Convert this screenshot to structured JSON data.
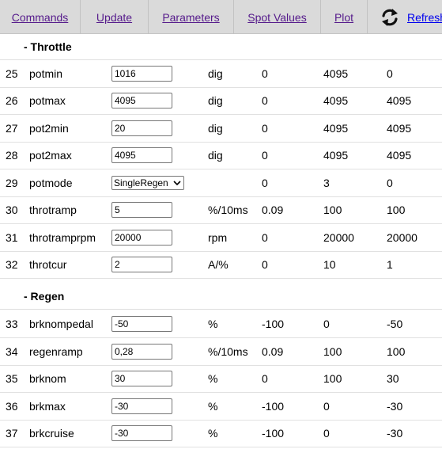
{
  "nav": {
    "items": [
      "Commands",
      "Update",
      "Parameters",
      "Spot Values",
      "Plot"
    ],
    "refresh_label": "Refresh"
  },
  "sections": [
    {
      "title": "- Throttle",
      "rows": [
        {
          "id": "25",
          "name": "potmin",
          "value": "1016",
          "unit": "dig",
          "min": "0",
          "max": "4095",
          "default": "0"
        },
        {
          "id": "26",
          "name": "potmax",
          "value": "4095",
          "unit": "dig",
          "min": "0",
          "max": "4095",
          "default": "4095"
        },
        {
          "id": "27",
          "name": "pot2min",
          "value": "20",
          "unit": "dig",
          "min": "0",
          "max": "4095",
          "default": "4095"
        },
        {
          "id": "28",
          "name": "pot2max",
          "value": "4095",
          "unit": "dig",
          "min": "0",
          "max": "4095",
          "default": "4095"
        },
        {
          "id": "29",
          "name": "potmode",
          "value": "SingleRegen",
          "unit": "",
          "min": "0",
          "max": "3",
          "default": "0",
          "control": "select"
        },
        {
          "id": "30",
          "name": "throtramp",
          "value": "5",
          "unit": "%/10ms",
          "min": "0.09",
          "max": "100",
          "default": "100"
        },
        {
          "id": "31",
          "name": "throtramprpm",
          "value": "20000",
          "unit": "rpm",
          "min": "0",
          "max": "20000",
          "default": "20000"
        },
        {
          "id": "32",
          "name": "throtcur",
          "value": "2",
          "unit": "A/%",
          "min": "0",
          "max": "10",
          "default": "1"
        }
      ]
    },
    {
      "title": "- Regen",
      "rows": [
        {
          "id": "33",
          "name": "brknompedal",
          "value": "-50",
          "unit": "%",
          "min": "-100",
          "max": "0",
          "default": "-50"
        },
        {
          "id": "34",
          "name": "regenramp",
          "value": "0,28",
          "unit": "%/10ms",
          "min": "0.09",
          "max": "100",
          "default": "100"
        },
        {
          "id": "35",
          "name": "brknom",
          "value": "30",
          "unit": "%",
          "min": "0",
          "max": "100",
          "default": "30"
        },
        {
          "id": "36",
          "name": "brkmax",
          "value": "-30",
          "unit": "%",
          "min": "-100",
          "max": "0",
          "default": "-30"
        },
        {
          "id": "37",
          "name": "brkcruise",
          "value": "-30",
          "unit": "%",
          "min": "-100",
          "max": "0",
          "default": "-30"
        }
      ]
    }
  ]
}
